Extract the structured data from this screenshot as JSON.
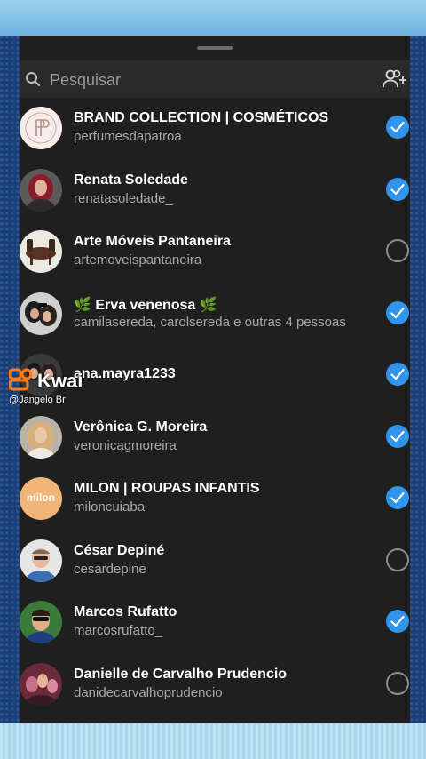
{
  "search": {
    "placeholder": "Pesquisar"
  },
  "accent_color": "#2f94ea",
  "contacts": [
    {
      "name": "BRAND COLLECTION | COSMÉTICOS",
      "username": "perfumesdapatroa",
      "selected": true,
      "avatar": "pp-monogram-logo"
    },
    {
      "name": "Renata Soledade",
      "username": "renatasoledade_",
      "selected": true,
      "avatar": "user-photo"
    },
    {
      "name": "Arte Móveis Pantaneira",
      "username": "artemoveispantaneira",
      "selected": false,
      "avatar": "furniture-photo"
    },
    {
      "name": "🌿 Erva venenosa 🌿",
      "username": "camilasereda, carolsereda e outras 4 pessoas",
      "selected": true,
      "avatar": "group-photo"
    },
    {
      "name": "ana.mayra1233",
      "username": "",
      "selected": true,
      "avatar": "user-photo"
    },
    {
      "name": "Verônica G. Moreira",
      "username": "veronicagmoreira",
      "selected": true,
      "avatar": "user-photo"
    },
    {
      "name": "MILON | ROUPAS INFANTIS",
      "username": "miloncuiaba",
      "selected": true,
      "avatar": "milon-logo"
    },
    {
      "name": "César Depiné",
      "username": "cesardepine",
      "selected": false,
      "avatar": "user-photo"
    },
    {
      "name": "Marcos  Rufatto",
      "username": "marcosrufatto_",
      "selected": true,
      "avatar": "user-photo"
    },
    {
      "name": "Danielle de Carvalho Prudencio",
      "username": "danidecarvalhoprudencio",
      "selected": false,
      "avatar": "user-photo"
    }
  ],
  "watermark": {
    "brand": "Kwai",
    "user": "@Jangelo Br"
  },
  "avatar_text": {
    "milon": "milon"
  }
}
